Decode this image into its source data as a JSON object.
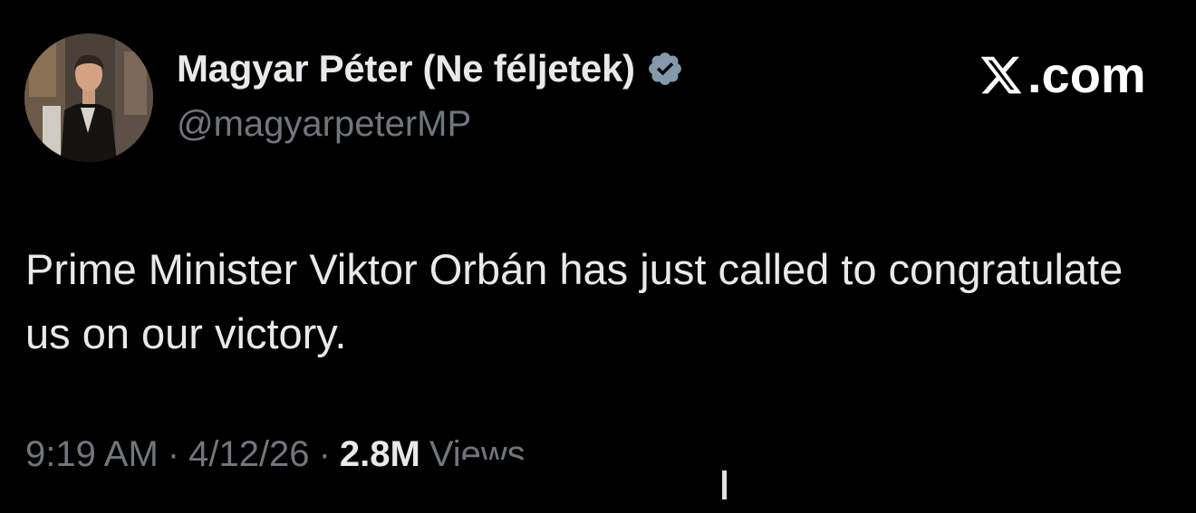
{
  "account": {
    "display_name": "Magyar Péter (Ne féljetek)",
    "handle": "@magyarpeterMP",
    "verified": true,
    "avatar_icon": "profile-photo"
  },
  "branding": {
    "site": ".com",
    "logo_icon": "x-logo-icon"
  },
  "tweet": {
    "text": "Prime Minister Viktor Orbán has just called to congratulate us on our victory."
  },
  "meta": {
    "time": "9:19 AM",
    "separator": "·",
    "date": "4/12/26",
    "views_count": "2.8M",
    "views_label": "Views"
  },
  "colors": {
    "background": "#000000",
    "primary_text": "#e7e9ea",
    "secondary_text": "#71767b",
    "verified_badge": "#829aab"
  }
}
